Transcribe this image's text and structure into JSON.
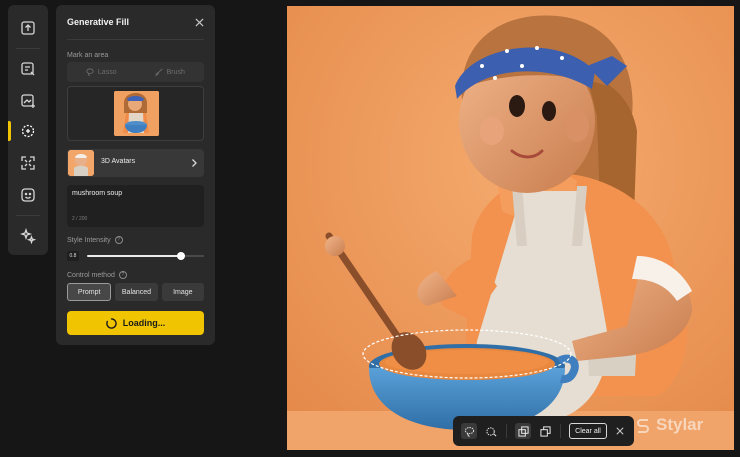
{
  "panel": {
    "title": "Generative Fill",
    "mark_area_label": "Mark an area",
    "mark_modes": [
      {
        "label": "Lasso",
        "icon": "lasso-icon",
        "active": false
      },
      {
        "label": "Brush",
        "icon": "brush-icon",
        "active": false
      }
    ],
    "style": {
      "name": "3D Avatars"
    },
    "prompt": {
      "value": "mushroom soup",
      "count": "2 / 200"
    },
    "style_intensity": {
      "label": "Style Intensity",
      "value": "0.8",
      "fraction": 0.8
    },
    "control_method": {
      "label": "Control method",
      "options": [
        "Prompt",
        "Balanced",
        "Image"
      ],
      "selected": "Prompt"
    },
    "generate_button": {
      "label": "Loading...",
      "state": "loading"
    }
  },
  "rail": {
    "tools": [
      "image-upload-icon",
      "image-edit-icon",
      "image-sparkle-icon",
      "magic-fill-icon",
      "expand-icon",
      "face-icon",
      "sparkles-icon"
    ],
    "active_tool": "magic-fill-icon"
  },
  "toolbar": {
    "tools": [
      "lasso-select-icon",
      "brush-select-icon",
      "add-selection-icon",
      "subtract-selection-icon"
    ],
    "clear_label": "Clear all"
  },
  "watermark": {
    "text": "Stylar"
  },
  "colors": {
    "accent": "#f0c400",
    "panel_bg": "#2a2a2a",
    "app_bg": "#161616",
    "canvas_bg": "#f0a062"
  }
}
